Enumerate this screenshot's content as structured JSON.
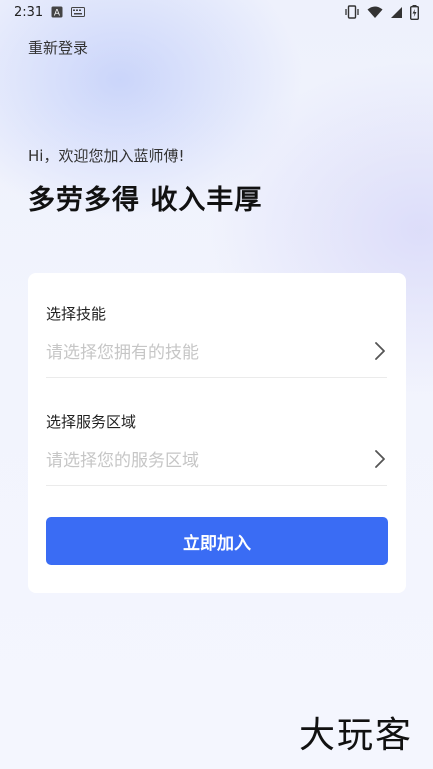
{
  "status_bar": {
    "time": "2:31",
    "icons": [
      "a-badge-icon",
      "keyboard-icon",
      "vibrate-icon",
      "wifi-icon",
      "signal-icon",
      "battery-charging-icon"
    ]
  },
  "header": {
    "relogin_label": "重新登录"
  },
  "hero": {
    "greeting": "Hi，欢迎您加入蓝师傅!",
    "headline": "多劳多得 收入丰厚"
  },
  "form": {
    "skills": {
      "label": "选择技能",
      "placeholder": "请选择您拥有的技能"
    },
    "area": {
      "label": "选择服务区域",
      "placeholder": "请选择您的服务区域"
    },
    "submit_label": "立即加入"
  },
  "watermark": {
    "text": "大玩客"
  },
  "colors": {
    "accent": "#3a6cf4",
    "placeholder": "#c6c6c6",
    "background": "#eef1fc"
  }
}
